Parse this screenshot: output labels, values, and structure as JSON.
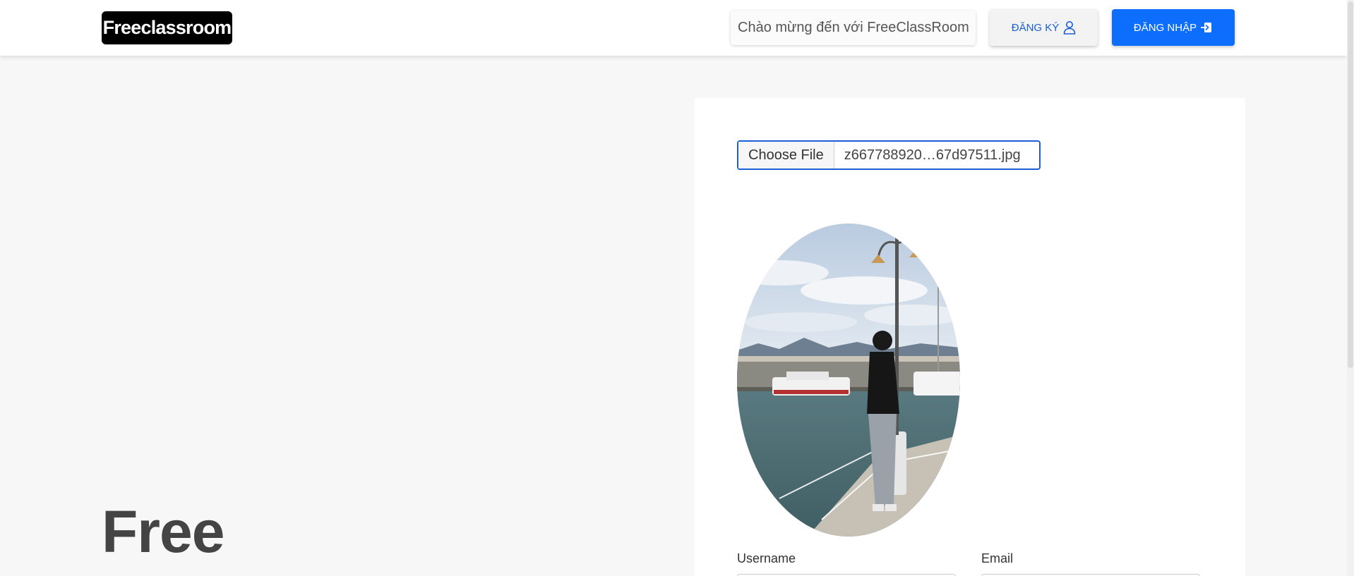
{
  "navbar": {
    "brand": "Freeclassroom",
    "welcome_text": "Chào mừng đến với FreeClassRoom",
    "register_label": "ĐĂNG KÝ",
    "register_icon": "user-icon",
    "login_label": "ĐĂNG NHẬP",
    "login_icon": "login-arrow-icon"
  },
  "hero": {
    "title": "Free"
  },
  "form": {
    "file_button_label": "Choose File",
    "file_name": "z667788920…67d97511.jpg",
    "avatar_alt": "avatar-preview",
    "username_label": "Username",
    "email_label": "Email",
    "username_value": "",
    "email_value": ""
  },
  "colors": {
    "primary": "#0d6efd",
    "register_text": "#1a5fd6",
    "page_bg": "#f7f7f7",
    "brand_bg": "#000000"
  }
}
